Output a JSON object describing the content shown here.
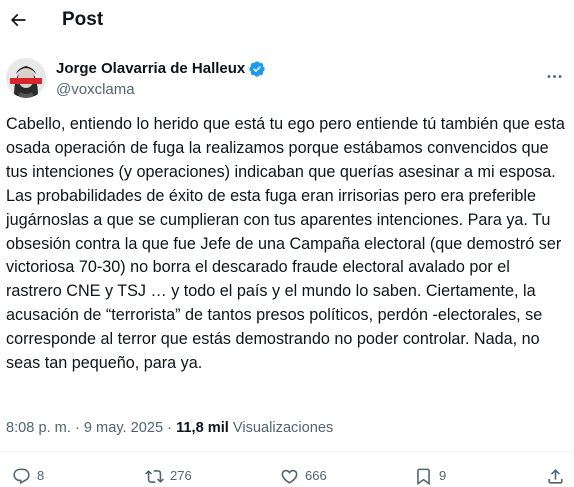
{
  "header": {
    "title": "Post"
  },
  "author": {
    "name": "Jorge Olavarria de Halleux",
    "handle": "@voxclama"
  },
  "tweet": {
    "text": "Cabello, entiendo lo herido que está tu ego pero entiende tú también que esta osada operación de fuga la realizamos porque estábamos convencidos que tus intenciones (y operaciones) indicaban que querías asesinar a mi esposa. Las probabilidades de éxito de esta fuga eran irrisorias pero era preferible jugárnoslas a que se cumplieran con tus aparentes intenciones. Para ya. Tu obsesión contra la que fue Jefe de una Campaña electoral (que demostró ser victoriosa 70-30) no borra el descarado fraude electoral avalado por el rastrero CNE y TSJ … y todo el país y el mundo lo saben. Ciertamente, la acusación de “terrorista” de tantos presos políticos, perdón -electorales, se corresponde al terror que estás demostrando no poder controlar. Nada, no seas tan pequeño, para ya."
  },
  "meta": {
    "time": "8:08 p. m.",
    "separator": " · ",
    "date": "9 may. 2025",
    "views_count": "11,8 mil",
    "views_label": "Visualizaciones"
  },
  "actions": {
    "replies": "8",
    "reposts": "276",
    "likes": "666",
    "bookmarks": "9"
  },
  "colors": {
    "text": "#0f1419",
    "secondary": "#536471",
    "verified": "#1d9bf0",
    "divider": "#eff3f4"
  },
  "icons": {
    "back": "arrow-left-icon",
    "more": "more-horizontal-icon",
    "verified": "verified-badge-icon",
    "reply": "reply-icon",
    "repost": "repost-icon",
    "like": "heart-icon",
    "bookmark": "bookmark-icon",
    "share": "share-icon"
  }
}
